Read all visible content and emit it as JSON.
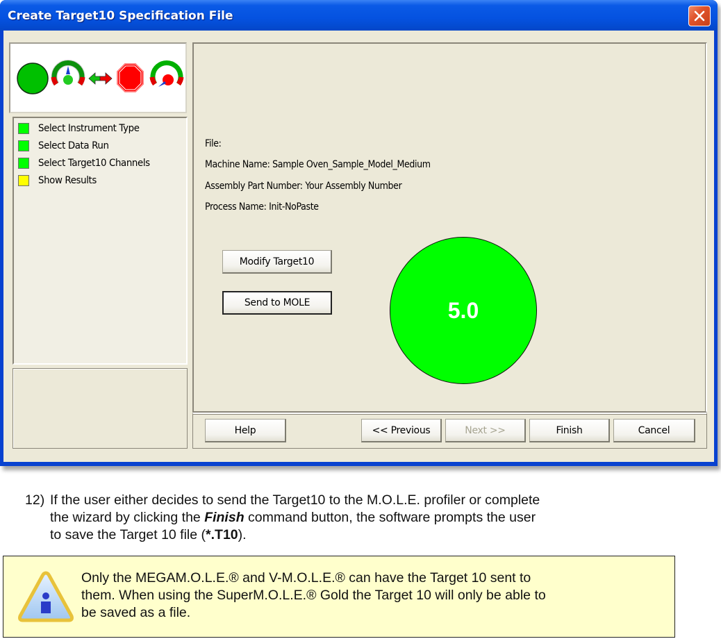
{
  "window": {
    "title": "Create Target10 Specification File",
    "close_icon": "close-icon"
  },
  "logo": {
    "icons": [
      "green-circle-icon",
      "green-gauge-icon",
      "bidirectional-arrow-icon",
      "red-stop-octagon-icon",
      "red-gauge-icon"
    ]
  },
  "steps": [
    {
      "label": "Select Instrument Type",
      "status_color": "#00ff00"
    },
    {
      "label": "Select Data Run",
      "status_color": "#00ff00"
    },
    {
      "label": "Select Target10 Channels",
      "status_color": "#00ff00"
    },
    {
      "label": "Show Results",
      "status_color": "#ffff00"
    }
  ],
  "info": {
    "file": "File:",
    "machine_name": "Machine Name: Sample Oven_Sample_Model_Medium",
    "assembly_part_number": "Assembly Part Number: Your Assembly Number",
    "process_name": "Process Name: Init-NoPaste"
  },
  "actions": {
    "modify_label": "Modify Target10",
    "send_label": "Send to MOLE"
  },
  "result": {
    "value": "5.0",
    "color": "#00ff00"
  },
  "nav": {
    "help": "Help",
    "previous": "<< Previous",
    "next": "Next >>",
    "finish": "Finish",
    "cancel": "Cancel"
  },
  "doc": {
    "step_number": "12)",
    "line1": "If the user either decides to send the Target10 to the M.O.L.E. profiler or complete",
    "line2_pre": "the wizard by clicking the ",
    "line2_emph": "Finish",
    "line2_post": " command button, the software prompts the user",
    "line3_pre": "to save the Target 10 file (",
    "line3_bold": "*.T10",
    "line3_post": ")."
  },
  "note": {
    "icon": "info-warning-icon",
    "lines": [
      "Only the MEGAM.O.L.E.® and V-M.O.L.E.® can have the Target 10 sent to",
      "them. When using the SuperM.O.L.E.® Gold the Target 10 will only be able to",
      "be saved as a file."
    ]
  }
}
